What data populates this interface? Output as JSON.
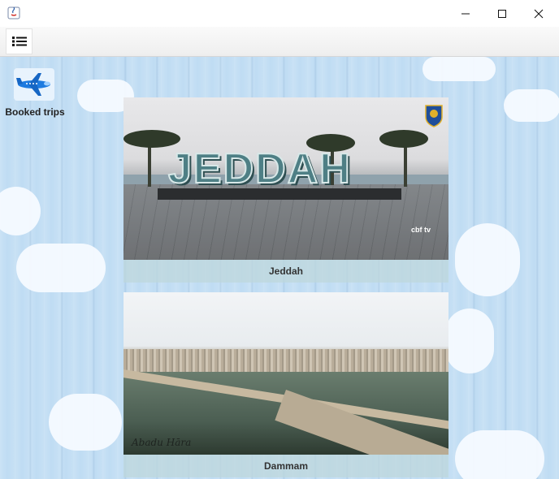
{
  "window": {
    "minimize_glyph": "─",
    "maximize_glyph": "☐",
    "close_glyph": "✕"
  },
  "toolbar": {
    "menu_icon": "list-icon"
  },
  "sidebar": {
    "booked_trips_label": "Booked trips",
    "booked_trips_icon": "airplane-icon"
  },
  "destinations": [
    {
      "name": "Jeddah",
      "photo_text": "JEDDAH",
      "watermark": "cbf tv"
    },
    {
      "name": "Dammam",
      "photo_signature": "Abadu Hāra"
    }
  ],
  "colors": {
    "wallpaper": "#bfdcf3",
    "caption_bg": "#bed7dc",
    "toolbar_bg": "#f2f2f2"
  }
}
